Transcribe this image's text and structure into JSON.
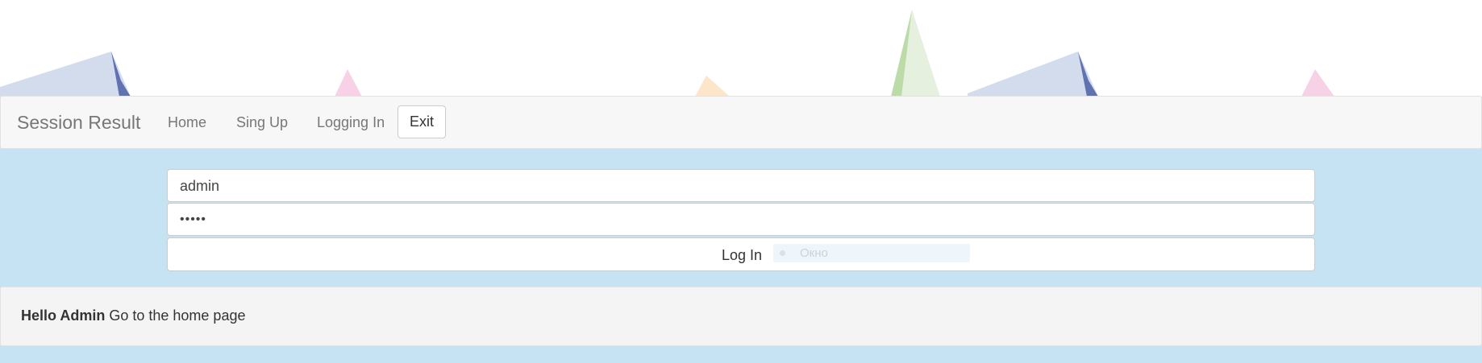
{
  "navbar": {
    "brand": "Session Result",
    "links": [
      "Home",
      "Sing Up",
      "Logging In"
    ],
    "exit_label": "Exit"
  },
  "form": {
    "username_value": "admin",
    "password_mask": "•••••",
    "login_label": "Log In",
    "window_label": "Окно"
  },
  "welcome": {
    "greeting": "Hello Admin",
    "link_text": "Go to the home page"
  },
  "colors": {
    "page_background": "#c6e3f3",
    "navbar_background": "#f7f7f7",
    "panel_background": "#f4f4f4"
  }
}
